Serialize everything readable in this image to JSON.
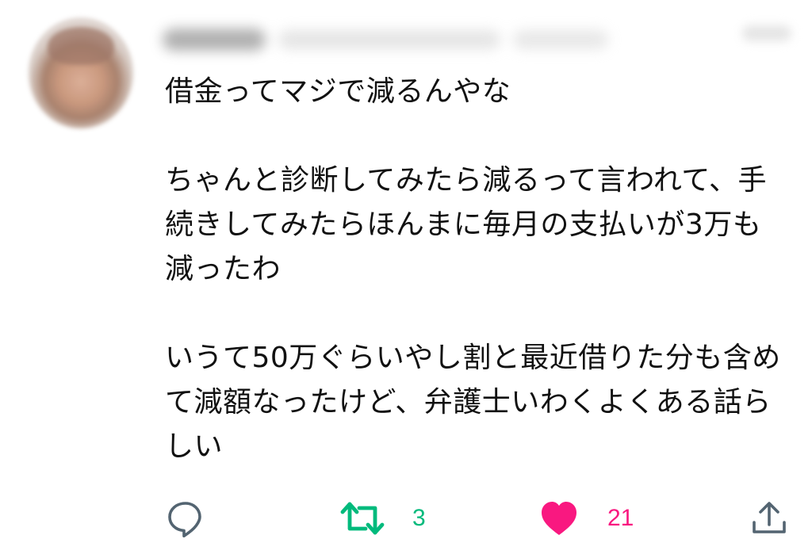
{
  "tweet": {
    "text": "借金ってマジで減るんやな\n\nちゃんと診断してみたら減るって言われて、手続きしてみたらほんまに毎月の支払いが3万も減ったわ\n\nいうて50万ぐらいやし割と最近借りた分も含めて減額なったけど、弁護士いわくよくある話らしい"
  },
  "actions": {
    "reply": {
      "icon": "reply-icon"
    },
    "retweet": {
      "icon": "retweet-icon",
      "count": "3",
      "color": "#00ba7c"
    },
    "like": {
      "icon": "heart-icon",
      "count": "21",
      "color": "#f91880"
    },
    "share": {
      "icon": "share-icon"
    }
  }
}
